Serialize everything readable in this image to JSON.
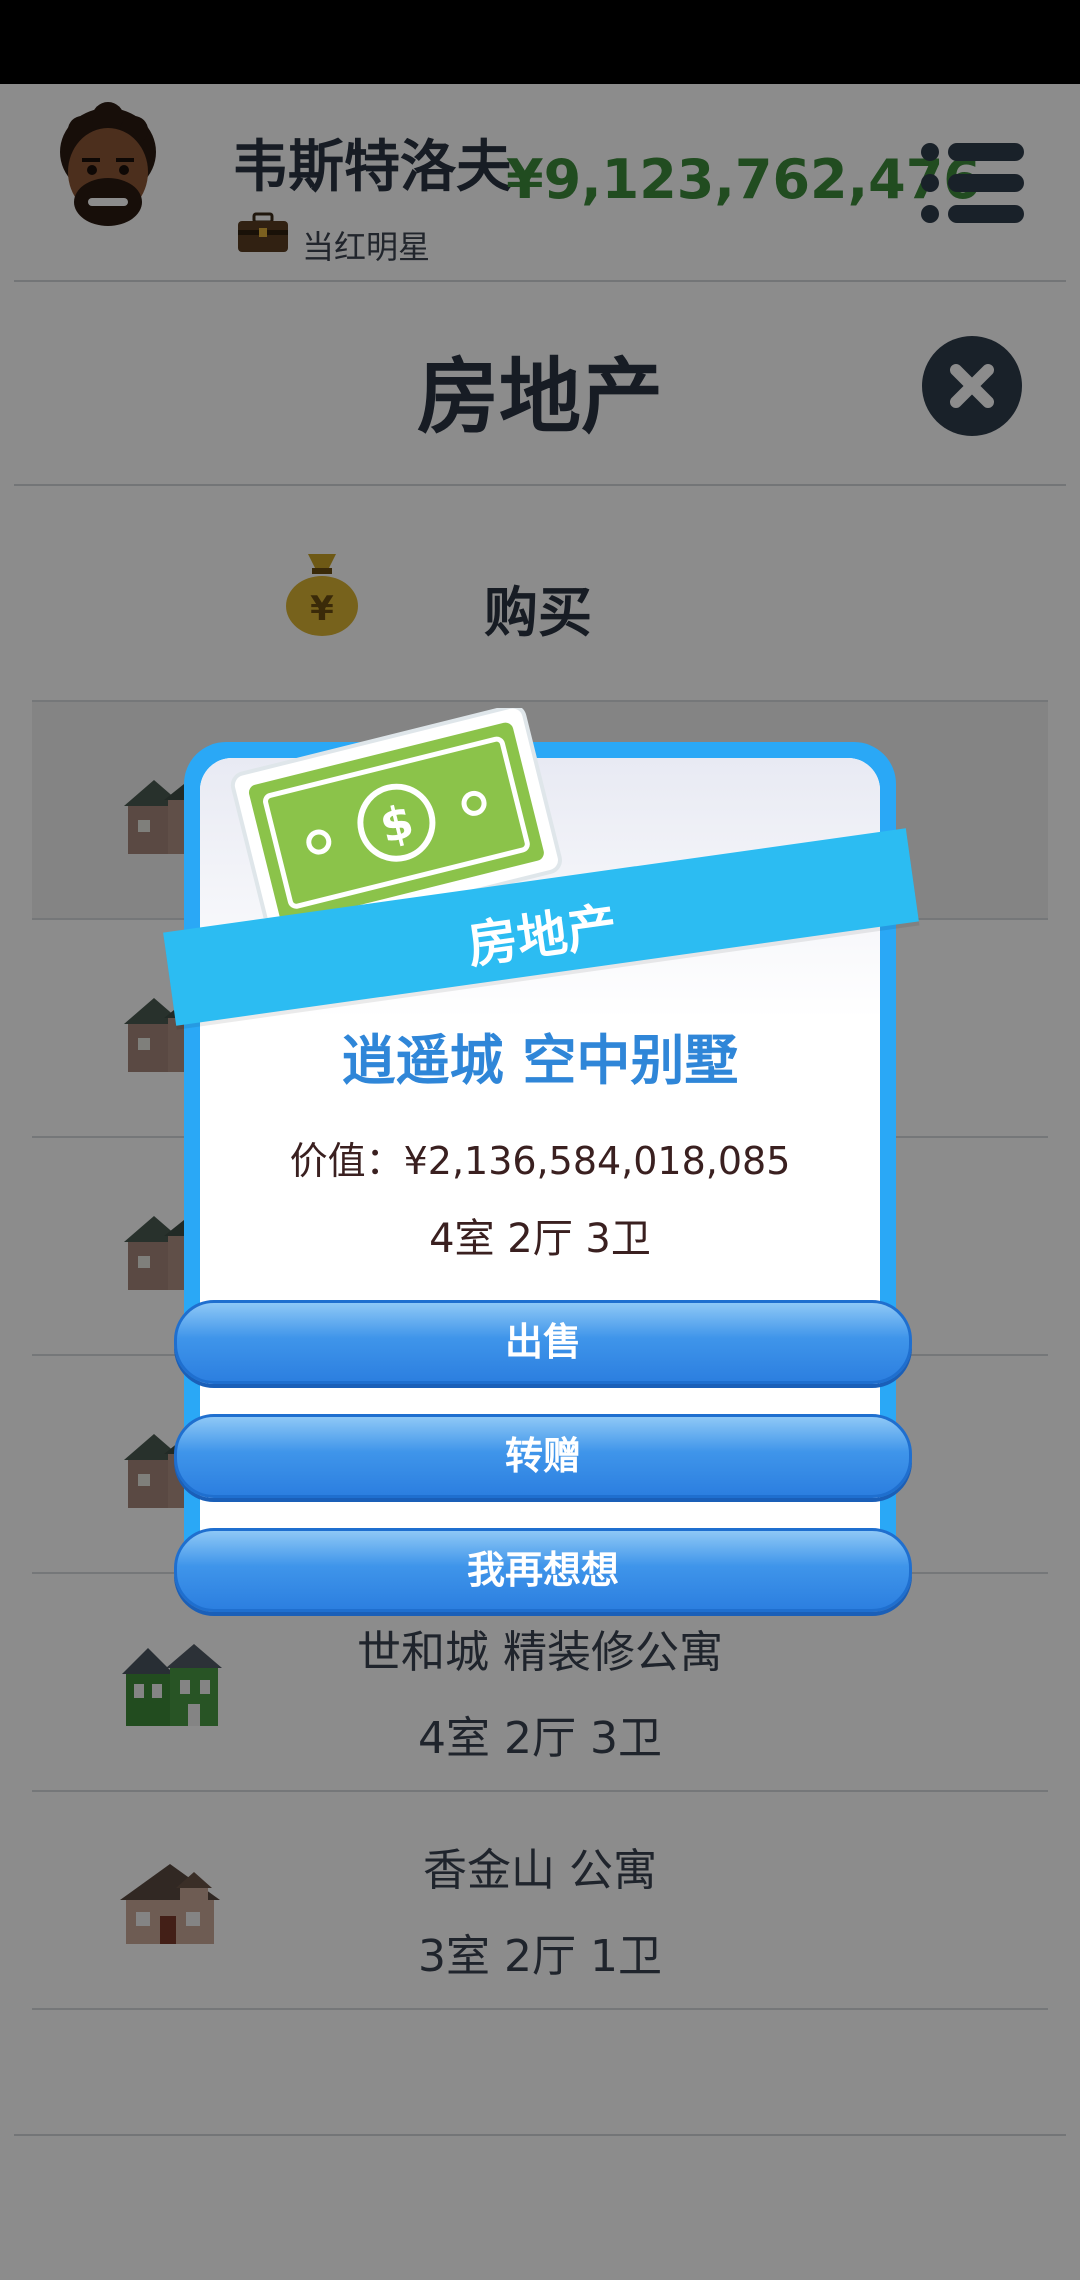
{
  "header": {
    "player_name": "韦斯特洛夫",
    "player_title": "当红明星",
    "money": "¥9,123,762,476"
  },
  "page": {
    "title": "房地产",
    "buy_label": "购买"
  },
  "properties": [
    {
      "name": "",
      "rooms": ""
    },
    {
      "name": "",
      "rooms": ""
    },
    {
      "name": "",
      "rooms": ""
    },
    {
      "name": "",
      "rooms": ""
    },
    {
      "name": "世和城 精装修公寓",
      "rooms": "4室 2厅 3卫"
    },
    {
      "name": "香金山 公寓",
      "rooms": "3室 2厅 1卫"
    }
  ],
  "modal": {
    "ribbon": "房地产",
    "property_name": "逍遥城 空中别墅",
    "value": "价值：¥2,136,584,018,085",
    "rooms": "4室 2厅 3卫",
    "sell_label": "出售",
    "gift_label": "转赠",
    "cancel_label": "我再想想"
  },
  "colors": {
    "money": "#3d8a3b",
    "accent_blue": "#2aa8f6",
    "property_name": "#2f86d8"
  }
}
